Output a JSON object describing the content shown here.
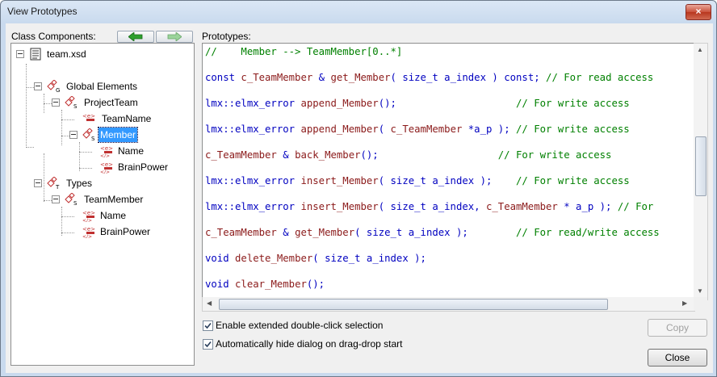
{
  "window": {
    "title": "View Prototypes",
    "close_glyph": "×"
  },
  "labels": {
    "class_components": "Class Components:",
    "prototypes": "Prototypes:"
  },
  "nav": {
    "back_icon": "green-left-arrow-icon",
    "forward_icon": "green-right-arrow-icon"
  },
  "tree": {
    "root": "team.xsd",
    "global_elements": "Global Elements",
    "project_team": "ProjectTeam",
    "team_name": "TeamName",
    "member": "Member",
    "name": "Name",
    "brain_power": "BrainPower",
    "types": "Types",
    "team_member": "TeamMember",
    "type_name": "Name",
    "type_brain_power": "BrainPower",
    "icon_badges": {
      "g": "G",
      "s": "S",
      "t": "T"
    }
  },
  "code": {
    "lines": [
      {
        "parts": [
          {
            "t": "//    Member --> TeamMember[0..*]",
            "c": "cm"
          }
        ]
      },
      {
        "parts": [
          {
            "t": "const ",
            "c": "kw"
          },
          {
            "t": "c_TeamMember",
            "c": "fn"
          },
          {
            "t": " & ",
            "c": "kw"
          },
          {
            "t": "get_Member",
            "c": "fn"
          },
          {
            "t": "( ",
            "c": "kw"
          },
          {
            "t": "size_t a_index",
            "c": "kw"
          },
          {
            "t": " ) const; ",
            "c": "kw"
          },
          {
            "t": "// For read access",
            "c": "cm"
          }
        ]
      },
      {
        "parts": [
          {
            "t": "lmx::elmx_error ",
            "c": "kw"
          },
          {
            "t": "append_Member",
            "c": "fn"
          },
          {
            "t": "();                    ",
            "c": "kw"
          },
          {
            "t": "// For write access",
            "c": "cm"
          }
        ]
      },
      {
        "parts": [
          {
            "t": "lmx::elmx_error ",
            "c": "kw"
          },
          {
            "t": "append_Member",
            "c": "fn"
          },
          {
            "t": "( ",
            "c": "kw"
          },
          {
            "t": "c_TeamMember",
            "c": "fn"
          },
          {
            "t": " *a_p ); ",
            "c": "kw"
          },
          {
            "t": "// For write access",
            "c": "cm"
          }
        ]
      },
      {
        "parts": [
          {
            "t": "c_TeamMember",
            "c": "fn"
          },
          {
            "t": " & ",
            "c": "kw"
          },
          {
            "t": "back_Member",
            "c": "fn"
          },
          {
            "t": "();                    ",
            "c": "kw"
          },
          {
            "t": "// For write access",
            "c": "cm"
          }
        ]
      },
      {
        "parts": [
          {
            "t": "lmx::elmx_error ",
            "c": "kw"
          },
          {
            "t": "insert_Member",
            "c": "fn"
          },
          {
            "t": "( size_t a_index );    ",
            "c": "kw"
          },
          {
            "t": "// For write access",
            "c": "cm"
          }
        ]
      },
      {
        "parts": [
          {
            "t": "lmx::elmx_error ",
            "c": "kw"
          },
          {
            "t": "insert_Member",
            "c": "fn"
          },
          {
            "t": "( size_t a_index, ",
            "c": "kw"
          },
          {
            "t": "c_TeamMember",
            "c": "fn"
          },
          {
            "t": " * a_p ); ",
            "c": "kw"
          },
          {
            "t": "// For",
            "c": "cm"
          }
        ]
      },
      {
        "parts": [
          {
            "t": "c_TeamMember",
            "c": "fn"
          },
          {
            "t": " & ",
            "c": "kw"
          },
          {
            "t": "get_Member",
            "c": "fn"
          },
          {
            "t": "( size_t a_index );        ",
            "c": "kw"
          },
          {
            "t": "// For read/write access",
            "c": "cm"
          }
        ]
      },
      {
        "parts": [
          {
            "t": "void ",
            "c": "kw"
          },
          {
            "t": "delete_Member",
            "c": "fn"
          },
          {
            "t": "( size_t a_index );",
            "c": "kw"
          }
        ]
      },
      {
        "parts": [
          {
            "t": "void ",
            "c": "kw"
          },
          {
            "t": "clear_Member",
            "c": "fn"
          },
          {
            "t": "();",
            "c": "kw"
          }
        ]
      }
    ]
  },
  "options": {
    "extended_dblclick": {
      "label": "Enable extended double-click selection",
      "checked": true
    },
    "auto_hide": {
      "label": "Automatically hide dialog on drag-drop start",
      "checked": true
    }
  },
  "buttons": {
    "copy": "Copy",
    "close": "Close"
  },
  "colors": {
    "keyword": "#0000c0",
    "function": "#8b1a1a",
    "comment": "#008000",
    "selection": "#3399ff"
  }
}
